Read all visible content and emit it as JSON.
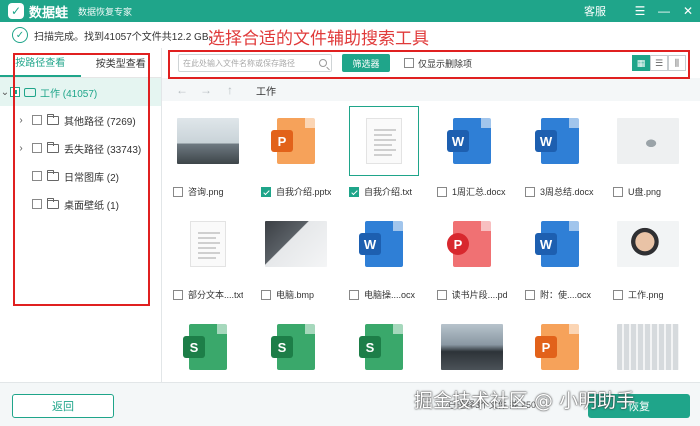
{
  "app": {
    "logo_text": "数据蛙",
    "product": "数据恢复专家",
    "customer_service": "客服",
    "window_buttons": [
      "☰",
      "—",
      "✕"
    ]
  },
  "status": {
    "text": "扫描完成。找到41057个文件共12.2 GB。"
  },
  "annotation": "选择合适的文件辅助搜索工具",
  "sidebar": {
    "tabs": [
      "按路径查看",
      "按类型查看"
    ],
    "active_tab": 0,
    "root": {
      "label": "工作 (41057)"
    },
    "items": [
      {
        "label": "其他路径 (7269)",
        "expandable": true
      },
      {
        "label": "丢失路径 (33743)",
        "expandable": true
      },
      {
        "label": "日常图库 (2)",
        "expandable": false
      },
      {
        "label": "桌面壁纸 (1)",
        "expandable": false
      }
    ]
  },
  "toolbar": {
    "search_placeholder": "在此处输入文件名称或保存路径",
    "filter_label": "筛选器",
    "deleted_only_label": "仅显示删除项"
  },
  "nav": {
    "back": "←",
    "forward": "→",
    "up": "↑",
    "breadcrumb": "工作"
  },
  "files": [
    {
      "name": "咨询.png",
      "kind": "photo",
      "photo": "office",
      "checked": false
    },
    {
      "name": "自我介绍.pptx",
      "kind": "ppt",
      "checked": true
    },
    {
      "name": "自我介绍.txt",
      "kind": "txt",
      "checked": true,
      "selected": true
    },
    {
      "name": "1周汇总.docx",
      "kind": "word",
      "checked": false
    },
    {
      "name": "3周总结.docx",
      "kind": "word",
      "checked": false
    },
    {
      "name": "U盘.png",
      "kind": "photo",
      "photo": "usb",
      "checked": false
    },
    {
      "name": "部分文本....txt",
      "kind": "txt",
      "checked": false
    },
    {
      "name": "电脑.bmp",
      "kind": "photo",
      "photo": "laptop",
      "checked": false
    },
    {
      "name": "电脑操....ocx",
      "kind": "word",
      "checked": false
    },
    {
      "name": "读书片段....pdf",
      "kind": "pdf",
      "checked": false
    },
    {
      "name": "附：使....ocx",
      "kind": "word",
      "checked": false
    },
    {
      "name": "工作.png",
      "kind": "photo",
      "photo": "service",
      "checked": false
    },
    {
      "name": "",
      "kind": "excel",
      "checked": false
    },
    {
      "name": "",
      "kind": "excel",
      "checked": false
    },
    {
      "name": "",
      "kind": "excel",
      "checked": false
    },
    {
      "name": "",
      "kind": "photo",
      "photo": "landscape",
      "checked": false
    },
    {
      "name": "",
      "kind": "ppt",
      "checked": false
    },
    {
      "name": "",
      "kind": "photo",
      "photo": "keyboard",
      "checked": false
    }
  ],
  "footer": {
    "back_label": "返回",
    "info": "已选择3个文件 共 250",
    "recover_label": "恢复"
  },
  "watermark": "掘金技术社区 @ 小明助手",
  "colors": {
    "brand": "#1fa58a",
    "annotation_red": "#e02020"
  }
}
